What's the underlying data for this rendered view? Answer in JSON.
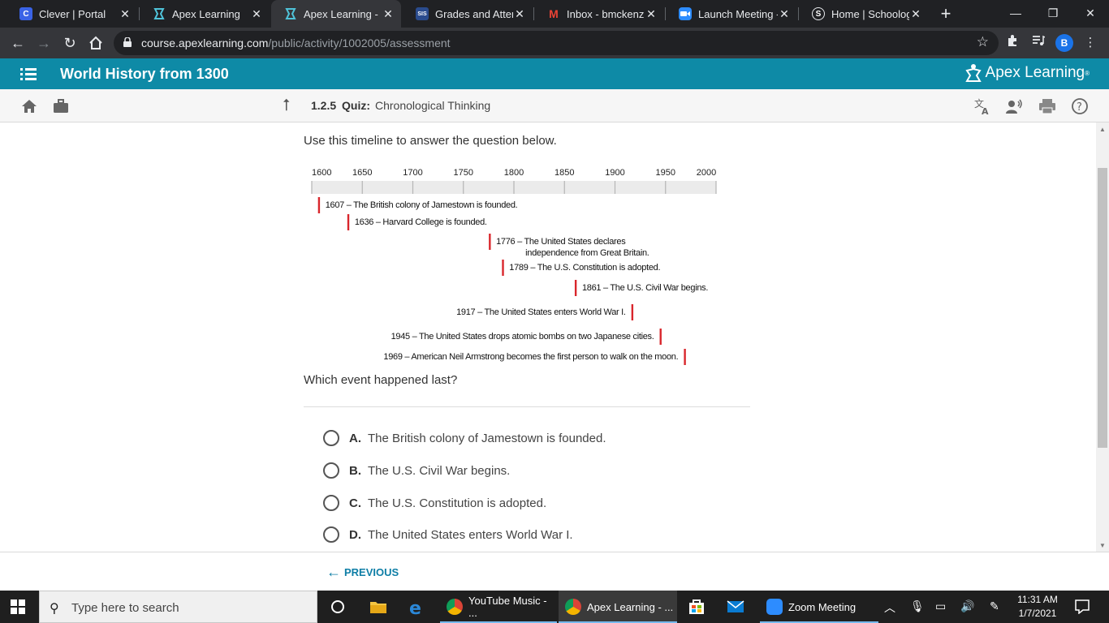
{
  "browser": {
    "tabs": [
      {
        "title": "Clever | Portal",
        "icon": "clever-icon",
        "color": "#3a63e6",
        "glyph": "C"
      },
      {
        "title": "Apex Learning",
        "icon": "apex-icon",
        "color": "#0e8aa6",
        "glyph": ""
      },
      {
        "title": "Apex Learning - Co",
        "icon": "apex-icon",
        "color": "#0e8aa6",
        "glyph": ""
      },
      {
        "title": "Grades and Attend",
        "icon": "sis-icon",
        "color": "#2a4b8d",
        "glyph": "SIS"
      },
      {
        "title": "Inbox - bmckenzie",
        "icon": "gmail-icon",
        "color": "#202124",
        "glyph": "M"
      },
      {
        "title": "Launch Meeting - ",
        "icon": "zoom-icon",
        "color": "#2d8cff",
        "glyph": ""
      },
      {
        "title": "Home | Schoology",
        "icon": "schoology-icon",
        "color": "#202124",
        "glyph": "S"
      }
    ],
    "active_tab": 2,
    "url_host": "course.apexlearning.com",
    "url_path": "/public/activity/1002005/assessment",
    "profile_initial": "B"
  },
  "apex": {
    "course_title": "World History from 1300",
    "brand": "Apex Learning",
    "brand_mark": "®",
    "activity_number": "1.2.5",
    "activity_kind": "Quiz:",
    "activity_title": "Chronological Thinking"
  },
  "quiz": {
    "prompt": "Use this timeline to answer the question below.",
    "question": "Which event happened last?",
    "choices": [
      {
        "letter": "A.",
        "text": "The British colony of Jamestown is founded."
      },
      {
        "letter": "B.",
        "text": "The U.S. Civil War begins."
      },
      {
        "letter": "C.",
        "text": "The U.S. Constitution is adopted."
      },
      {
        "letter": "D.",
        "text": "The United States enters World War I."
      }
    ],
    "previous_label": "PREVIOUS"
  },
  "chart_data": {
    "type": "scatter",
    "axis_ticks": [
      "1600",
      "1650",
      "1700",
      "1750",
      "1800",
      "1850",
      "1900",
      "1950",
      "2000"
    ],
    "xlim": [
      1600,
      2000
    ],
    "marker_color": "#d9262c",
    "events": [
      {
        "year": 1607,
        "lines": [
          "1607 – The British colony of Jamestown is founded."
        ],
        "side": "right"
      },
      {
        "year": 1636,
        "lines": [
          "1636 – Harvard College is founded."
        ],
        "side": "right"
      },
      {
        "year": 1776,
        "lines": [
          "1776 – The United States declares",
          "independence from Great Britain."
        ],
        "side": "right"
      },
      {
        "year": 1789,
        "lines": [
          "1789 – The U.S. Constitution is adopted."
        ],
        "side": "right"
      },
      {
        "year": 1861,
        "lines": [
          "1861 – The U.S. Civil War begins."
        ],
        "side": "right"
      },
      {
        "year": 1917,
        "lines": [
          "1917 – The United States enters World War I."
        ],
        "side": "left"
      },
      {
        "year": 1945,
        "lines": [
          "1945 – The United States drops atomic bombs on two Japanese cities."
        ],
        "side": "left"
      },
      {
        "year": 1969,
        "lines": [
          "1969 – American Neil Armstrong becomes the first person to walk on the moon."
        ],
        "side": "left"
      }
    ]
  },
  "taskbar": {
    "search_placeholder": "Type here to search",
    "apps": [
      {
        "label": "YouTube Music - ...",
        "icon": "chrome-icon"
      },
      {
        "label": "Apex Learning - ...",
        "icon": "chrome-icon"
      },
      {
        "label": "Zoom Meeting",
        "icon": "zoom-icon"
      }
    ],
    "time": "11:31 AM",
    "date": "1/7/2021"
  }
}
